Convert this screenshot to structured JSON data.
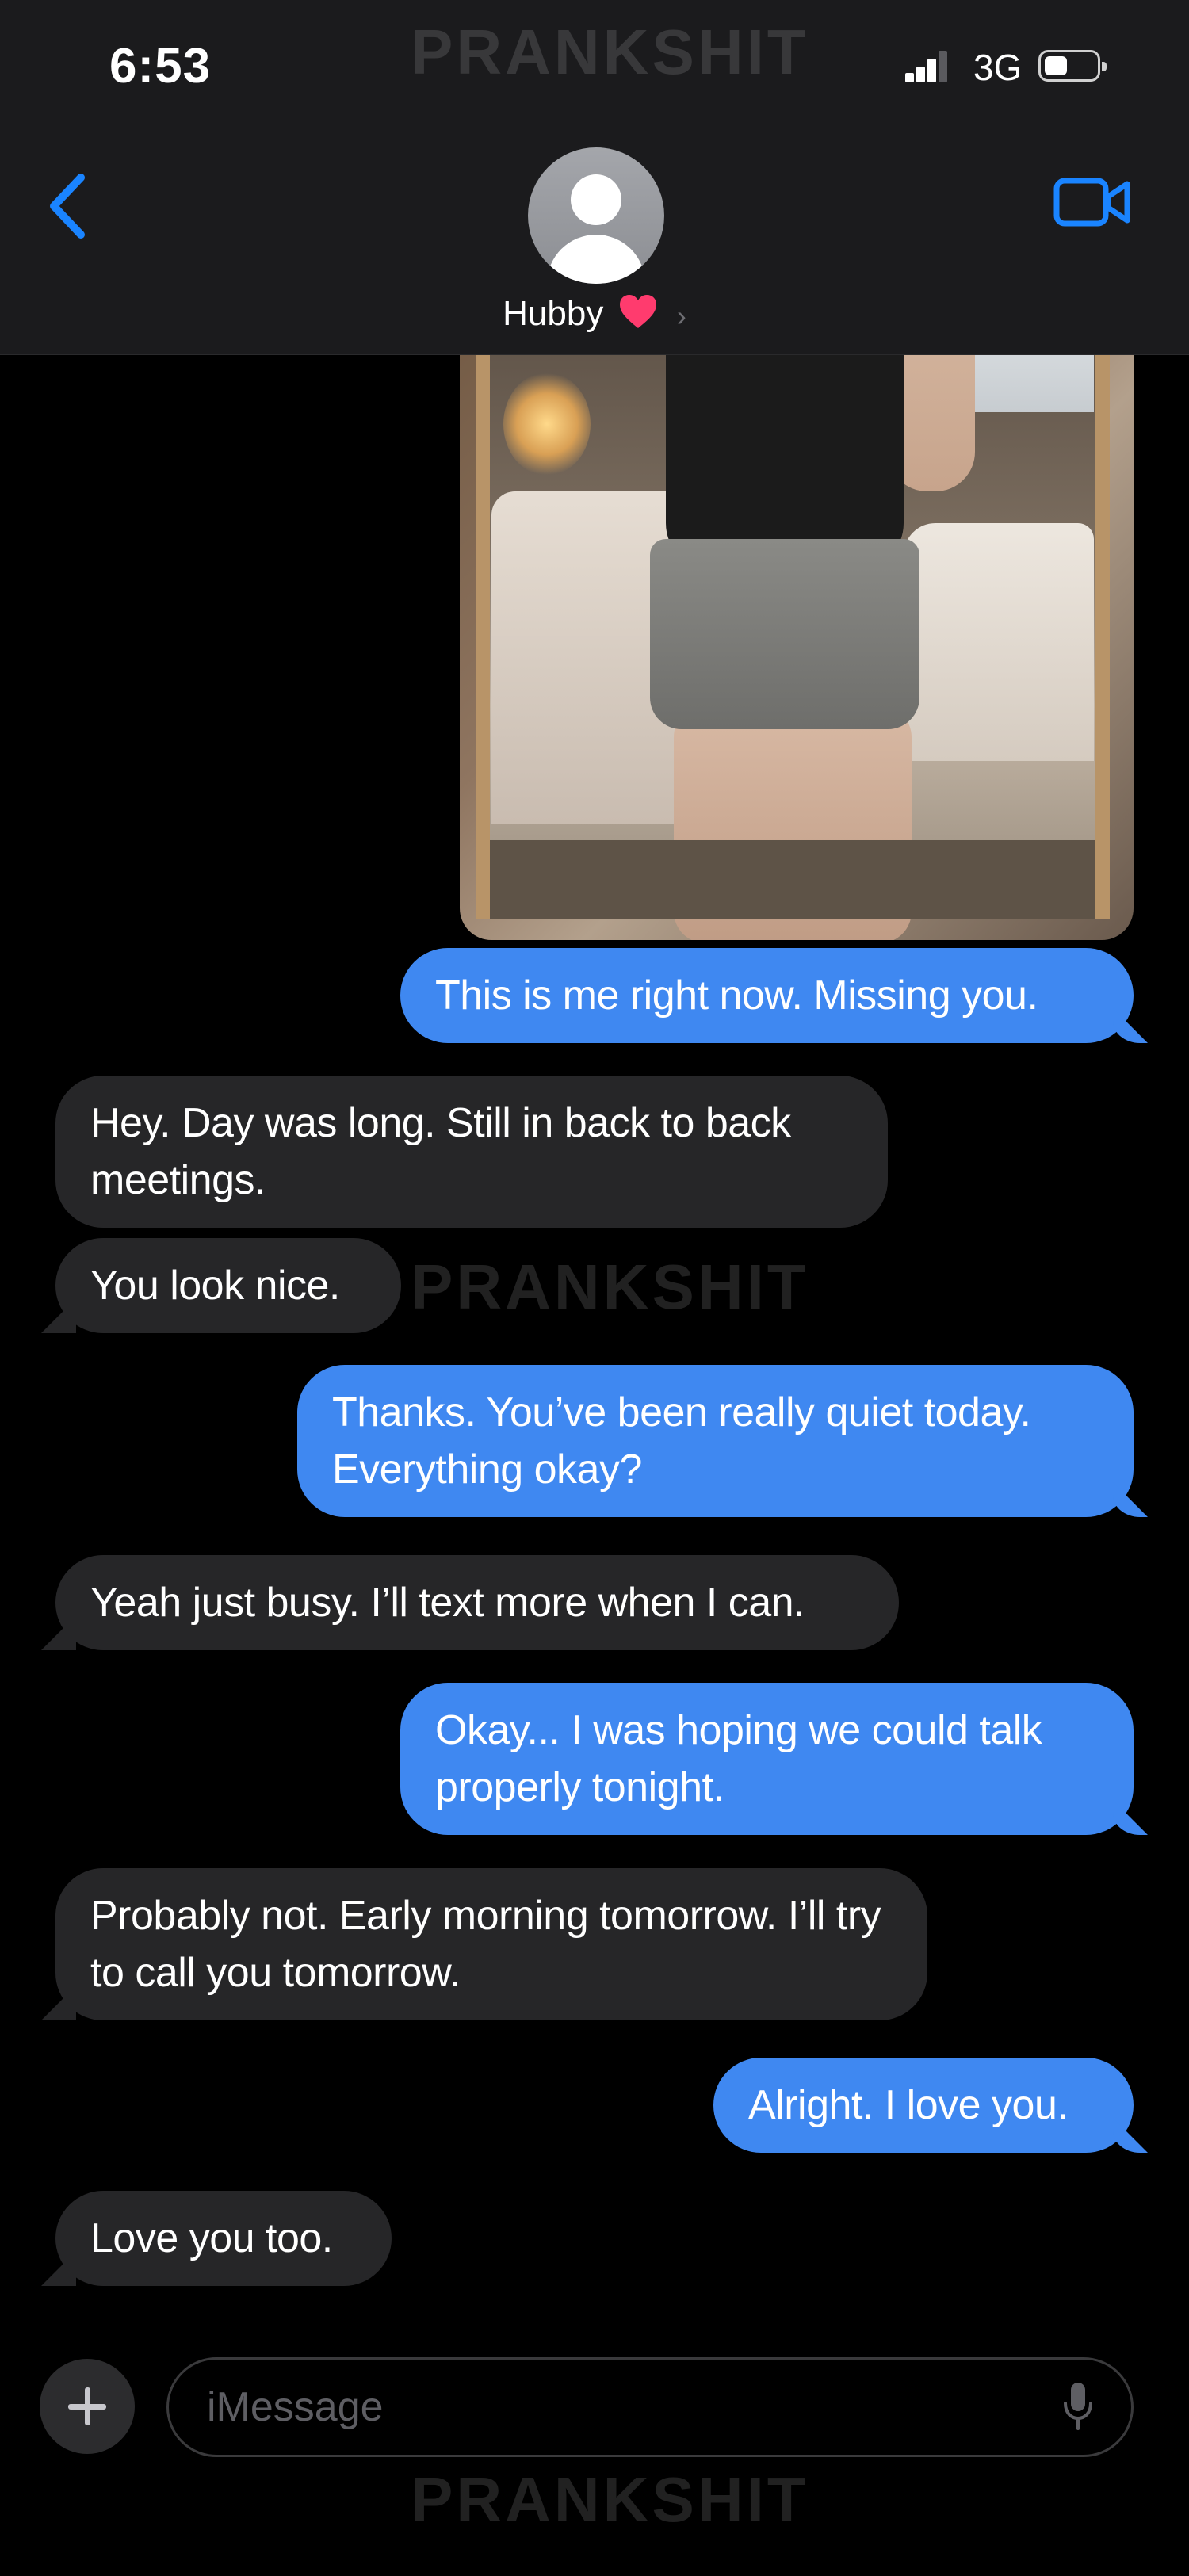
{
  "status_bar": {
    "time": "6:53",
    "network": "3G"
  },
  "header": {
    "contact_name": "Hubby",
    "chevron": "›"
  },
  "colors": {
    "outgoing_bubble": "#3f88f1",
    "incoming_bubble": "#262628",
    "accent": "#1a84ff",
    "header_bg": "#1b1b1d",
    "heart": "#ff3b6e"
  },
  "icons": [
    "back-chevron-icon",
    "facetime-video-icon",
    "contact-avatar-icon",
    "heart-icon",
    "plus-icon",
    "microphone-icon",
    "signal-icon",
    "battery-icon"
  ],
  "watermark": "PRANKSHIT",
  "messages": [
    {
      "dir": "out",
      "text": "This is me right now. Missing you."
    },
    {
      "dir": "in",
      "text": "Hey. Day was long. Still in back to back meetings."
    },
    {
      "dir": "in",
      "text": "You look nice."
    },
    {
      "dir": "out",
      "text": "Thanks. You’ve been really quiet today. Everything okay?"
    },
    {
      "dir": "in",
      "text": "Yeah just busy. I’ll text more when I can."
    },
    {
      "dir": "out",
      "text": "Okay... I was hoping we could talk properly tonight."
    },
    {
      "dir": "in",
      "text": "Probably not. Early morning tomorrow. I’ll try to call you tomorrow."
    },
    {
      "dir": "out",
      "text": "Alright. I love you."
    },
    {
      "dir": "in",
      "text": "Love you too."
    }
  ],
  "composer": {
    "placeholder": "iMessage"
  }
}
